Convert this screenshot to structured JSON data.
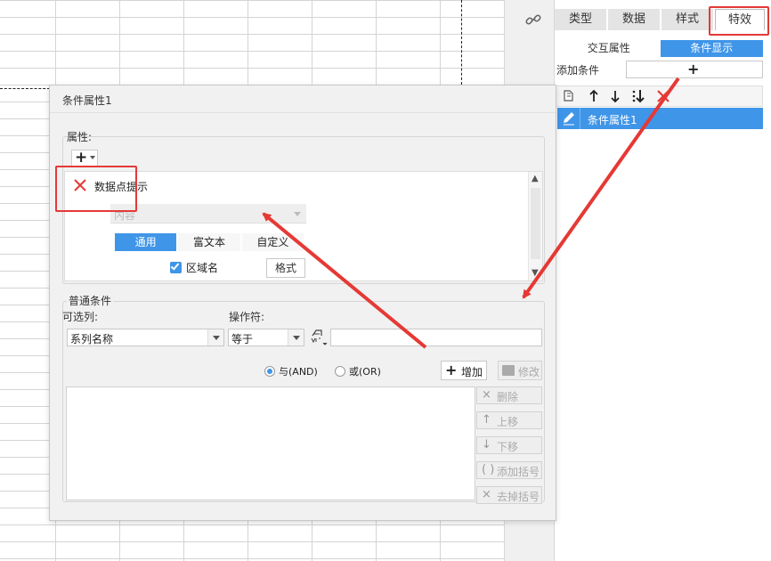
{
  "right_panel": {
    "tabs": [
      {
        "label": "类型"
      },
      {
        "label": "数据"
      },
      {
        "label": "样式"
      },
      {
        "label": "特效"
      }
    ],
    "sub_tabs": [
      {
        "label": "交互属性"
      },
      {
        "label": "条件显示"
      }
    ],
    "add_condition_label": "添加条件",
    "add_condition_plus": "+",
    "condition_list": [
      {
        "label": "条件属性1"
      }
    ]
  },
  "dialog": {
    "title": "条件属性1",
    "attributes_label": "属性:",
    "attribute_add_plus": "+",
    "data_tip_label": "数据点提示",
    "content_select_label": "内容",
    "mode_tabs": [
      {
        "label": "通用"
      },
      {
        "label": "富文本"
      },
      {
        "label": "自定义"
      }
    ],
    "region_name_label": "区域名",
    "format_button": "格式",
    "common_condition_label": "普通条件",
    "column_label": "可选列:",
    "operator_label": "操作符:",
    "column_value": "系列名称",
    "operator_value": "等于",
    "value_input": "",
    "and_label": "与(AND)",
    "or_label": "或(OR)",
    "add_button": "增加",
    "modify_button": "修改",
    "side_buttons": [
      {
        "icon": "×",
        "label": "删除"
      },
      {
        "icon": "↑",
        "label": "上移"
      },
      {
        "icon": "↓",
        "label": "下移"
      },
      {
        "icon": "( )",
        "label": "添加括号"
      },
      {
        "icon": "×",
        "label": "去掉括号"
      }
    ]
  },
  "colors": {
    "accent": "#3f95e8",
    "annotation": "#e53935"
  }
}
